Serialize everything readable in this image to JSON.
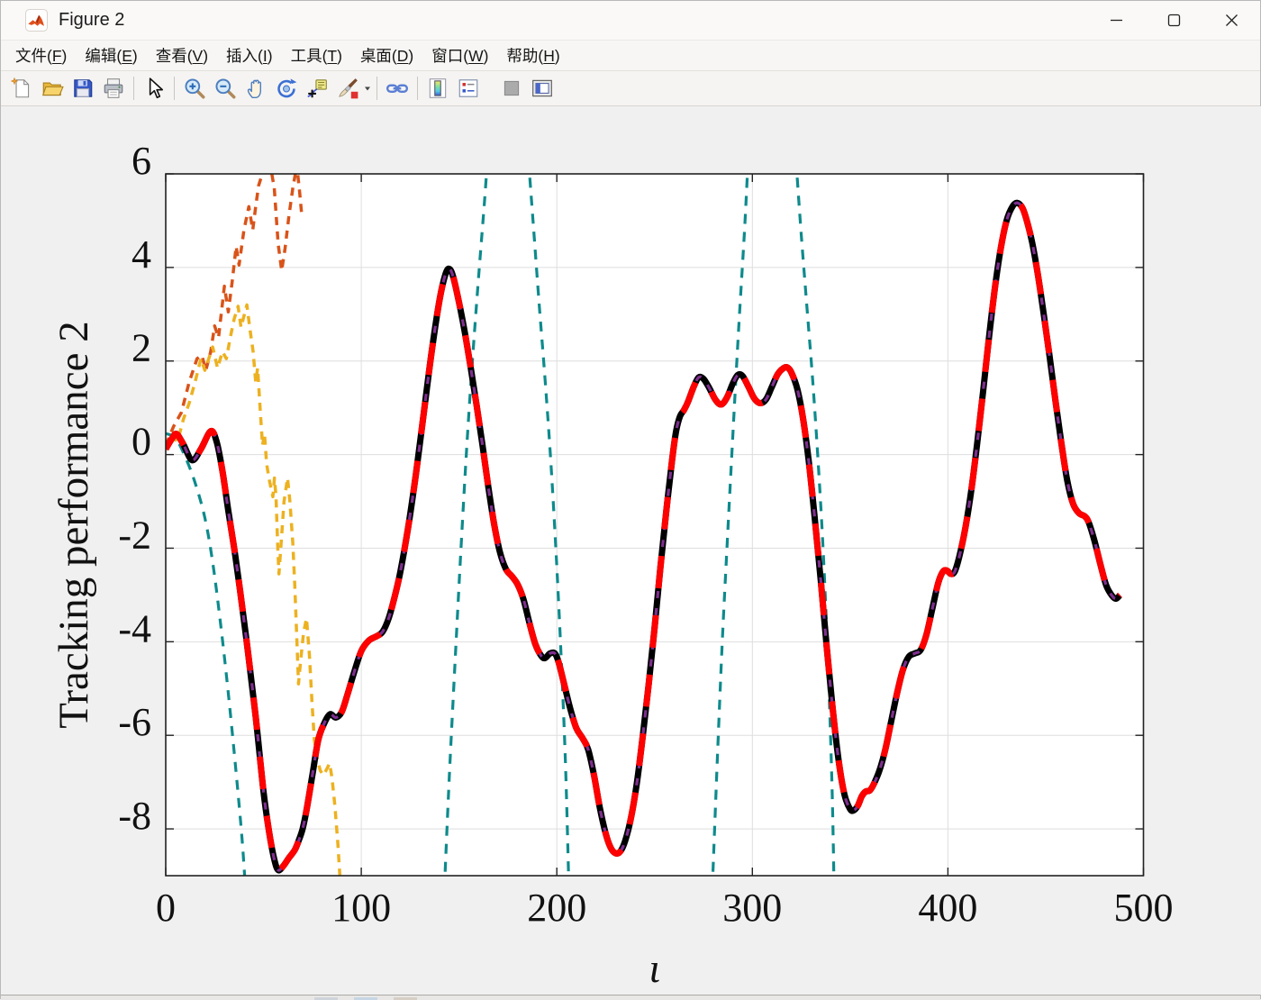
{
  "window": {
    "title": "Figure 2",
    "controls": {
      "minimize": "minimize",
      "maximize": "maximize",
      "close": "close"
    }
  },
  "menu": {
    "items": [
      "文件(F)",
      "编辑(E)",
      "查看(V)",
      "插入(I)",
      "工具(T)",
      "桌面(D)",
      "窗口(W)",
      "帮助(H)"
    ]
  },
  "toolbar": {
    "buttons": [
      "new-figure",
      "open-file",
      "save-figure",
      "print-figure",
      "|",
      "pointer",
      "|",
      "zoom-in",
      "zoom-out",
      "pan",
      "rotate-3d",
      "data-cursor",
      "brush",
      "caret",
      "|",
      "link-plots",
      "|",
      "insert-colorbar",
      "insert-legend",
      "gap",
      "hide-plot-tools",
      "show-plot-tools"
    ]
  },
  "chart_data": {
    "type": "line",
    "title": "",
    "xlabel": "ι",
    "ylabel": "Tracking performance 2",
    "xlim": [
      0,
      500
    ],
    "ylim": [
      -9,
      6
    ],
    "x_ticks": [
      0,
      100,
      200,
      300,
      400,
      500
    ],
    "y_ticks": [
      -8,
      -6,
      -4,
      -2,
      0,
      2,
      4,
      6
    ],
    "grid": true,
    "legend_position": "none",
    "main_curve": [
      [
        0,
        0.12
      ],
      [
        3,
        0.33
      ],
      [
        5.5,
        0.44
      ],
      [
        9,
        0.22
      ],
      [
        13.5,
        -0.12
      ],
      [
        18,
        0.12
      ],
      [
        23,
        0.5
      ],
      [
        26,
        0.28
      ],
      [
        29,
        -0.35
      ],
      [
        32,
        -1.2
      ],
      [
        35,
        -2.0
      ],
      [
        38,
        -2.9
      ],
      [
        42,
        -4.2
      ],
      [
        46,
        -5.6
      ],
      [
        50,
        -7.2
      ],
      [
        53,
        -8.1
      ],
      [
        55.5,
        -8.65
      ],
      [
        57.5,
        -8.88
      ],
      [
        60,
        -8.8
      ],
      [
        63,
        -8.62
      ],
      [
        66,
        -8.45
      ],
      [
        68,
        -8.25
      ],
      [
        70,
        -8.0
      ],
      [
        72,
        -7.6
      ],
      [
        75,
        -6.85
      ],
      [
        78,
        -6.1
      ],
      [
        81,
        -5.75
      ],
      [
        84,
        -5.55
      ],
      [
        87,
        -5.62
      ],
      [
        90,
        -5.5
      ],
      [
        93,
        -5.12
      ],
      [
        96,
        -4.7
      ],
      [
        100,
        -4.2
      ],
      [
        104,
        -3.97
      ],
      [
        108,
        -3.88
      ],
      [
        111,
        -3.78
      ],
      [
        114,
        -3.5
      ],
      [
        117,
        -3.05
      ],
      [
        120,
        -2.5
      ],
      [
        124,
        -1.55
      ],
      [
        128,
        -0.4
      ],
      [
        132,
        0.9
      ],
      [
        136,
        2.2
      ],
      [
        140,
        3.3
      ],
      [
        143,
        3.85
      ],
      [
        145,
        3.97
      ],
      [
        147,
        3.8
      ],
      [
        150,
        3.25
      ],
      [
        153,
        2.6
      ],
      [
        156,
        1.85
      ],
      [
        159,
        1.05
      ],
      [
        162,
        0.2
      ],
      [
        165,
        -0.7
      ],
      [
        168,
        -1.5
      ],
      [
        171,
        -2.1
      ],
      [
        174,
        -2.45
      ],
      [
        177,
        -2.6
      ],
      [
        180,
        -2.78
      ],
      [
        183,
        -3.1
      ],
      [
        186,
        -3.6
      ],
      [
        189,
        -4.05
      ],
      [
        192,
        -4.3
      ],
      [
        194,
        -4.35
      ],
      [
        196.5,
        -4.25
      ],
      [
        199,
        -4.25
      ],
      [
        201,
        -4.45
      ],
      [
        204,
        -4.95
      ],
      [
        207,
        -5.45
      ],
      [
        210,
        -5.85
      ],
      [
        213,
        -6.05
      ],
      [
        216,
        -6.3
      ],
      [
        219,
        -6.85
      ],
      [
        222,
        -7.55
      ],
      [
        225,
        -8.1
      ],
      [
        227.5,
        -8.4
      ],
      [
        230,
        -8.52
      ],
      [
        232.5,
        -8.48
      ],
      [
        235,
        -8.25
      ],
      [
        238,
        -7.75
      ],
      [
        241,
        -7.0
      ],
      [
        244,
        -6.0
      ],
      [
        247,
        -4.9
      ],
      [
        250,
        -3.7
      ],
      [
        253,
        -2.4
      ],
      [
        256,
        -1.2
      ],
      [
        259,
        -0.1
      ],
      [
        261,
        0.5
      ],
      [
        263,
        0.82
      ],
      [
        265,
        0.95
      ],
      [
        267,
        1.12
      ],
      [
        270,
        1.45
      ],
      [
        272.5,
        1.65
      ],
      [
        275,
        1.62
      ],
      [
        278,
        1.42
      ],
      [
        281,
        1.18
      ],
      [
        284,
        1.07
      ],
      [
        287,
        1.22
      ],
      [
        290,
        1.52
      ],
      [
        292.5,
        1.7
      ],
      [
        295,
        1.68
      ],
      [
        298,
        1.45
      ],
      [
        301,
        1.2
      ],
      [
        304,
        1.1
      ],
      [
        307,
        1.18
      ],
      [
        310,
        1.45
      ],
      [
        313,
        1.72
      ],
      [
        316,
        1.85
      ],
      [
        318,
        1.86
      ],
      [
        320,
        1.75
      ],
      [
        323,
        1.4
      ],
      [
        326,
        0.75
      ],
      [
        329,
        -0.2
      ],
      [
        332,
        -1.4
      ],
      [
        335,
        -2.7
      ],
      [
        338,
        -4.1
      ],
      [
        341,
        -5.4
      ],
      [
        344,
        -6.5
      ],
      [
        347,
        -7.25
      ],
      [
        350,
        -7.58
      ],
      [
        352,
        -7.6
      ],
      [
        354,
        -7.5
      ],
      [
        356,
        -7.3
      ],
      [
        358,
        -7.2
      ],
      [
        360,
        -7.18
      ],
      [
        362,
        -7.05
      ],
      [
        365,
        -6.75
      ],
      [
        368,
        -6.3
      ],
      [
        371,
        -5.7
      ],
      [
        374,
        -5.1
      ],
      [
        377,
        -4.6
      ],
      [
        380,
        -4.32
      ],
      [
        383,
        -4.25
      ],
      [
        386,
        -4.18
      ],
      [
        389,
        -3.85
      ],
      [
        392,
        -3.3
      ],
      [
        395,
        -2.75
      ],
      [
        397.5,
        -2.5
      ],
      [
        399.5,
        -2.48
      ],
      [
        401.5,
        -2.55
      ],
      [
        403.5,
        -2.5
      ],
      [
        406,
        -2.15
      ],
      [
        409,
        -1.55
      ],
      [
        412,
        -0.75
      ],
      [
        415,
        0.25
      ],
      [
        418,
        1.35
      ],
      [
        421,
        2.5
      ],
      [
        424,
        3.55
      ],
      [
        427,
        4.4
      ],
      [
        430,
        5.0
      ],
      [
        433,
        5.3
      ],
      [
        435.5,
        5.38
      ],
      [
        438,
        5.28
      ],
      [
        440,
        5.05
      ],
      [
        443,
        4.55
      ],
      [
        446,
        3.85
      ],
      [
        449,
        3.0
      ],
      [
        452,
        2.1
      ],
      [
        455,
        1.15
      ],
      [
        458,
        0.25
      ],
      [
        461,
        -0.55
      ],
      [
        464,
        -1.05
      ],
      [
        467,
        -1.25
      ],
      [
        470,
        -1.32
      ],
      [
        472,
        -1.45
      ],
      [
        475,
        -1.85
      ],
      [
        478,
        -2.35
      ],
      [
        481,
        -2.8
      ],
      [
        484,
        -3.02
      ],
      [
        486,
        -3.08
      ],
      [
        488,
        -3.0
      ]
    ],
    "series": [
      {
        "name": "teal-reference",
        "color": "#0E8A8C",
        "width": 3.2,
        "dash": [
          11,
          9
        ],
        "smooth": true,
        "segments": [
          [
            [
              0,
              0.45
            ],
            [
              5,
              0.35
            ],
            [
              10,
              -0.05
            ],
            [
              15,
              -0.6
            ],
            [
              20,
              -1.35
            ],
            [
              24,
              -2.3
            ],
            [
              28,
              -3.6
            ],
            [
              32,
              -5.1
            ],
            [
              36,
              -6.8
            ],
            [
              39,
              -8.2
            ],
            [
              40.8,
              -9.3
            ]
          ],
          [
            [
              142.5,
              -9.3
            ],
            [
              145,
              -6.9
            ],
            [
              148,
              -4.4
            ],
            [
              151,
              -2.0
            ],
            [
              154,
              0.2
            ],
            [
              157,
              2.1
            ],
            [
              160,
              3.8
            ],
            [
              163,
              5.4
            ],
            [
              164.5,
              6.3
            ]
          ],
          [
            [
              185.5,
              6.3
            ],
            [
              188,
              4.9
            ],
            [
              191,
              3.2
            ],
            [
              194,
              1.6
            ],
            [
              197,
              -0.2
            ],
            [
              200,
              -2.4
            ],
            [
              202.5,
              -4.6
            ],
            [
              204.5,
              -6.7
            ],
            [
              206.2,
              -9.3
            ]
          ],
          [
            [
              279.5,
              -9.3
            ],
            [
              282,
              -6.6
            ],
            [
              284.5,
              -4.1
            ],
            [
              287,
              -2.0
            ],
            [
              290,
              0.4
            ],
            [
              293,
              2.7
            ],
            [
              296,
              4.8
            ],
            [
              297.8,
              6.3
            ]
          ],
          [
            [
              322.3,
              6.3
            ],
            [
              325,
              4.7
            ],
            [
              328,
              3.1
            ],
            [
              331,
              1.5
            ],
            [
              334,
              -0.4
            ],
            [
              336.5,
              -2.3
            ],
            [
              339,
              -4.8
            ],
            [
              340.8,
              -7.2
            ],
            [
              341.8,
              -9.3
            ]
          ]
        ]
      },
      {
        "name": "orange-signal",
        "color": "#D95319",
        "width": 3.5,
        "dash": [
          9,
          7
        ],
        "smooth": false,
        "segments": [
          [
            [
              0,
              0.2
            ],
            [
              4,
              0.6
            ],
            [
              8,
              0.9
            ],
            [
              12,
              1.55
            ],
            [
              16,
              2.05
            ],
            [
              18.5,
              2.12
            ],
            [
              20.5,
              1.8
            ],
            [
              23,
              2.2
            ],
            [
              25,
              2.75
            ],
            [
              27,
              2.5
            ],
            [
              30,
              3.6
            ],
            [
              32,
              3.05
            ],
            [
              34,
              3.7
            ],
            [
              36,
              4.45
            ],
            [
              37.5,
              4.05
            ],
            [
              40,
              4.8
            ],
            [
              42.5,
              5.3
            ],
            [
              44.5,
              4.8
            ],
            [
              46,
              5.3
            ],
            [
              47.5,
              5.75
            ],
            [
              49,
              5.95
            ],
            [
              51,
              6.15
            ],
            [
              53,
              6.3
            ],
            [
              55.5,
              5.7
            ],
            [
              57.5,
              4.5
            ],
            [
              59.3,
              3.93
            ],
            [
              61,
              4.4
            ],
            [
              63,
              5.1
            ],
            [
              65,
              5.7
            ],
            [
              66.5,
              6.05
            ],
            [
              67.5,
              6.0
            ],
            [
              68.5,
              5.6
            ],
            [
              69.6,
              5.1
            ]
          ]
        ]
      },
      {
        "name": "yellow-signal",
        "color": "#EDB120",
        "width": 3.5,
        "dash": [
          9,
          7
        ],
        "smooth": false,
        "segments": [
          [
            [
              0,
              0.1
            ],
            [
              3,
              0.4
            ],
            [
              6,
              0.28
            ],
            [
              9,
              0.75
            ],
            [
              12,
              1.1
            ],
            [
              15,
              1.55
            ],
            [
              18,
              2.05
            ],
            [
              20,
              1.8
            ],
            [
              24,
              2.3
            ],
            [
              26.5,
              1.85
            ],
            [
              29,
              2.2
            ],
            [
              31,
              2.05
            ],
            [
              33,
              2.5
            ],
            [
              35,
              2.9
            ],
            [
              37,
              3.17
            ],
            [
              38.5,
              2.72
            ],
            [
              41.5,
              3.2
            ],
            [
              43,
              2.7
            ],
            [
              44.7,
              2.2
            ],
            [
              46,
              1.55
            ],
            [
              47,
              1.85
            ],
            [
              48.4,
              0.9
            ],
            [
              49.5,
              0.2
            ],
            [
              50.5,
              0.45
            ],
            [
              51.6,
              -0.2
            ],
            [
              53,
              -0.55
            ],
            [
              54.8,
              -0.9
            ],
            [
              55.6,
              -0.5
            ],
            [
              56.4,
              -0.9
            ],
            [
              57.3,
              -2.0
            ],
            [
              57.9,
              -2.55
            ],
            [
              59,
              -1.9
            ],
            [
              60.5,
              -1.0
            ],
            [
              62.3,
              -0.5
            ],
            [
              63.5,
              -1.0
            ],
            [
              65,
              -1.9
            ],
            [
              66,
              -2.8
            ],
            [
              67,
              -3.9
            ],
            [
              67.9,
              -4.9
            ],
            [
              69,
              -4.4
            ],
            [
              70.5,
              -3.8
            ],
            [
              72,
              -3.5
            ],
            [
              73.5,
              -4.3
            ],
            [
              74.8,
              -5.3
            ],
            [
              76,
              -6.1
            ],
            [
              77.5,
              -6.5
            ],
            [
              79,
              -6.75
            ],
            [
              80.5,
              -6.85
            ],
            [
              82,
              -6.75
            ],
            [
              83.8,
              -6.6
            ],
            [
              85,
              -6.9
            ],
            [
              86.5,
              -7.5
            ],
            [
              88,
              -8.3
            ],
            [
              89.5,
              -9.3
            ]
          ]
        ]
      },
      {
        "name": "actual-trajectory",
        "color": "#000000",
        "width": 7,
        "dash": null,
        "smooth": true,
        "points": "main"
      },
      {
        "name": "estimate-purple",
        "color": "#7E2F8E",
        "width": 3.2,
        "dash": [
          8,
          11
        ],
        "smooth": true,
        "points": "main"
      },
      {
        "name": "tracking-output-red",
        "color": "#FF0000",
        "width": 7,
        "dash": [
          36,
          30
        ],
        "smooth": true,
        "points": "main"
      }
    ]
  }
}
